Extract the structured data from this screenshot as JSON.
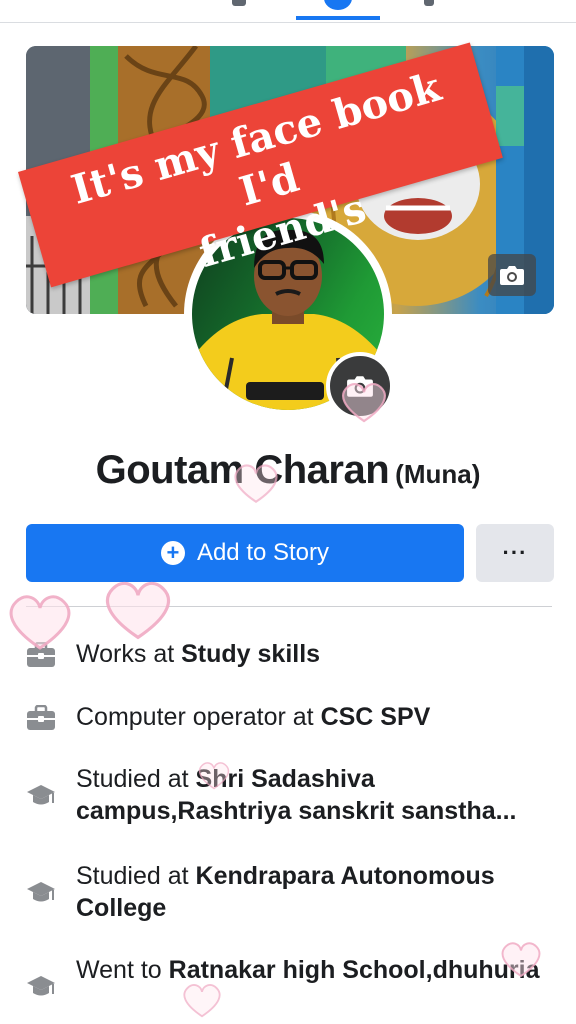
{
  "banner": {
    "text": "It's my face book I'd\nfriend's"
  },
  "profile": {
    "name": "Goutam Charan",
    "nickname": "(Muna)"
  },
  "actions": {
    "add_story_label": "Add to Story",
    "more_label": "···"
  },
  "info": [
    {
      "icon": "briefcase-icon",
      "prefix": "Works at ",
      "bold": "Study skills"
    },
    {
      "icon": "briefcase-icon",
      "prefix": "Computer operator at ",
      "bold": "CSC SPV"
    },
    {
      "icon": "graduation-cap-icon",
      "prefix": "Studied at ",
      "bold": "Shri Sadashiva campus,Rashtriya sanskrit sanstha..."
    },
    {
      "icon": "graduation-cap-icon",
      "prefix": "Studied at ",
      "bold": "Kendrapara Autonomous College"
    },
    {
      "icon": "graduation-cap-icon",
      "prefix": "Went to ",
      "bold": "Ratnakar high School,dhuhuria"
    }
  ],
  "colors": {
    "primary": "#1877f2",
    "banner": "#ec4438",
    "secondary_button": "#e4e6eb",
    "text": "#1c1e21",
    "icon": "#8a8d91"
  }
}
